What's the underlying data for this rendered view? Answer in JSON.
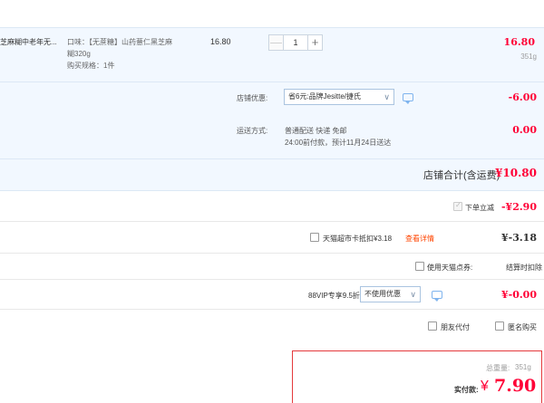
{
  "product": {
    "title": "芝麻糊中老年无...",
    "spec_lines": [
      "口味：【无蔗糖】山药薏仁黑芝麻",
      "糊320g",
      "购买规格：1件"
    ],
    "unit_price": "16.80",
    "quantity": "1",
    "minus": "—",
    "plus": "+",
    "subtotal": "16.80",
    "weight": "351g"
  },
  "shop": {
    "promo_label": "店铺优惠:",
    "promo_value": "省6元:品牌Jesitte/捷氏",
    "promo_amount": "-6.00",
    "shipping_label": "运送方式:",
    "shipping_line1": "普通配送 快递 免邮",
    "shipping_line2": "24:00前付款，预计11月24日送达",
    "shipping_amount": "0.00",
    "total_label": "店铺合计(含运费)",
    "total_amount": "¥10.80"
  },
  "discounts": {
    "instant_label": "下单立减",
    "instant_amount": "-¥2.90",
    "tmall_card_label": "天猫超市卡抵扣¥3.18",
    "tmall_card_link": "查看详情",
    "tmall_card_amount": "¥-3.18",
    "points_label": "使用天猫点券:",
    "points_value": "结算时扣除",
    "vip_label": "88VIP专享9.5折",
    "vip_select": "不使用优惠",
    "vip_amount": "¥-0.00",
    "friend_pay": "朋友代付",
    "anonymous": "匿名购买"
  },
  "payment": {
    "weight_label": "总重量:",
    "weight_value": "351g",
    "actual_label": "实付款:",
    "currency": "¥",
    "amount": "7.90"
  },
  "colors": {
    "accent": "#ff0036",
    "link": "#f40",
    "band": "#f2f8ff"
  },
  "icons": [
    "chevron-down-icon",
    "chat-icon",
    "checkbox-icon"
  ]
}
